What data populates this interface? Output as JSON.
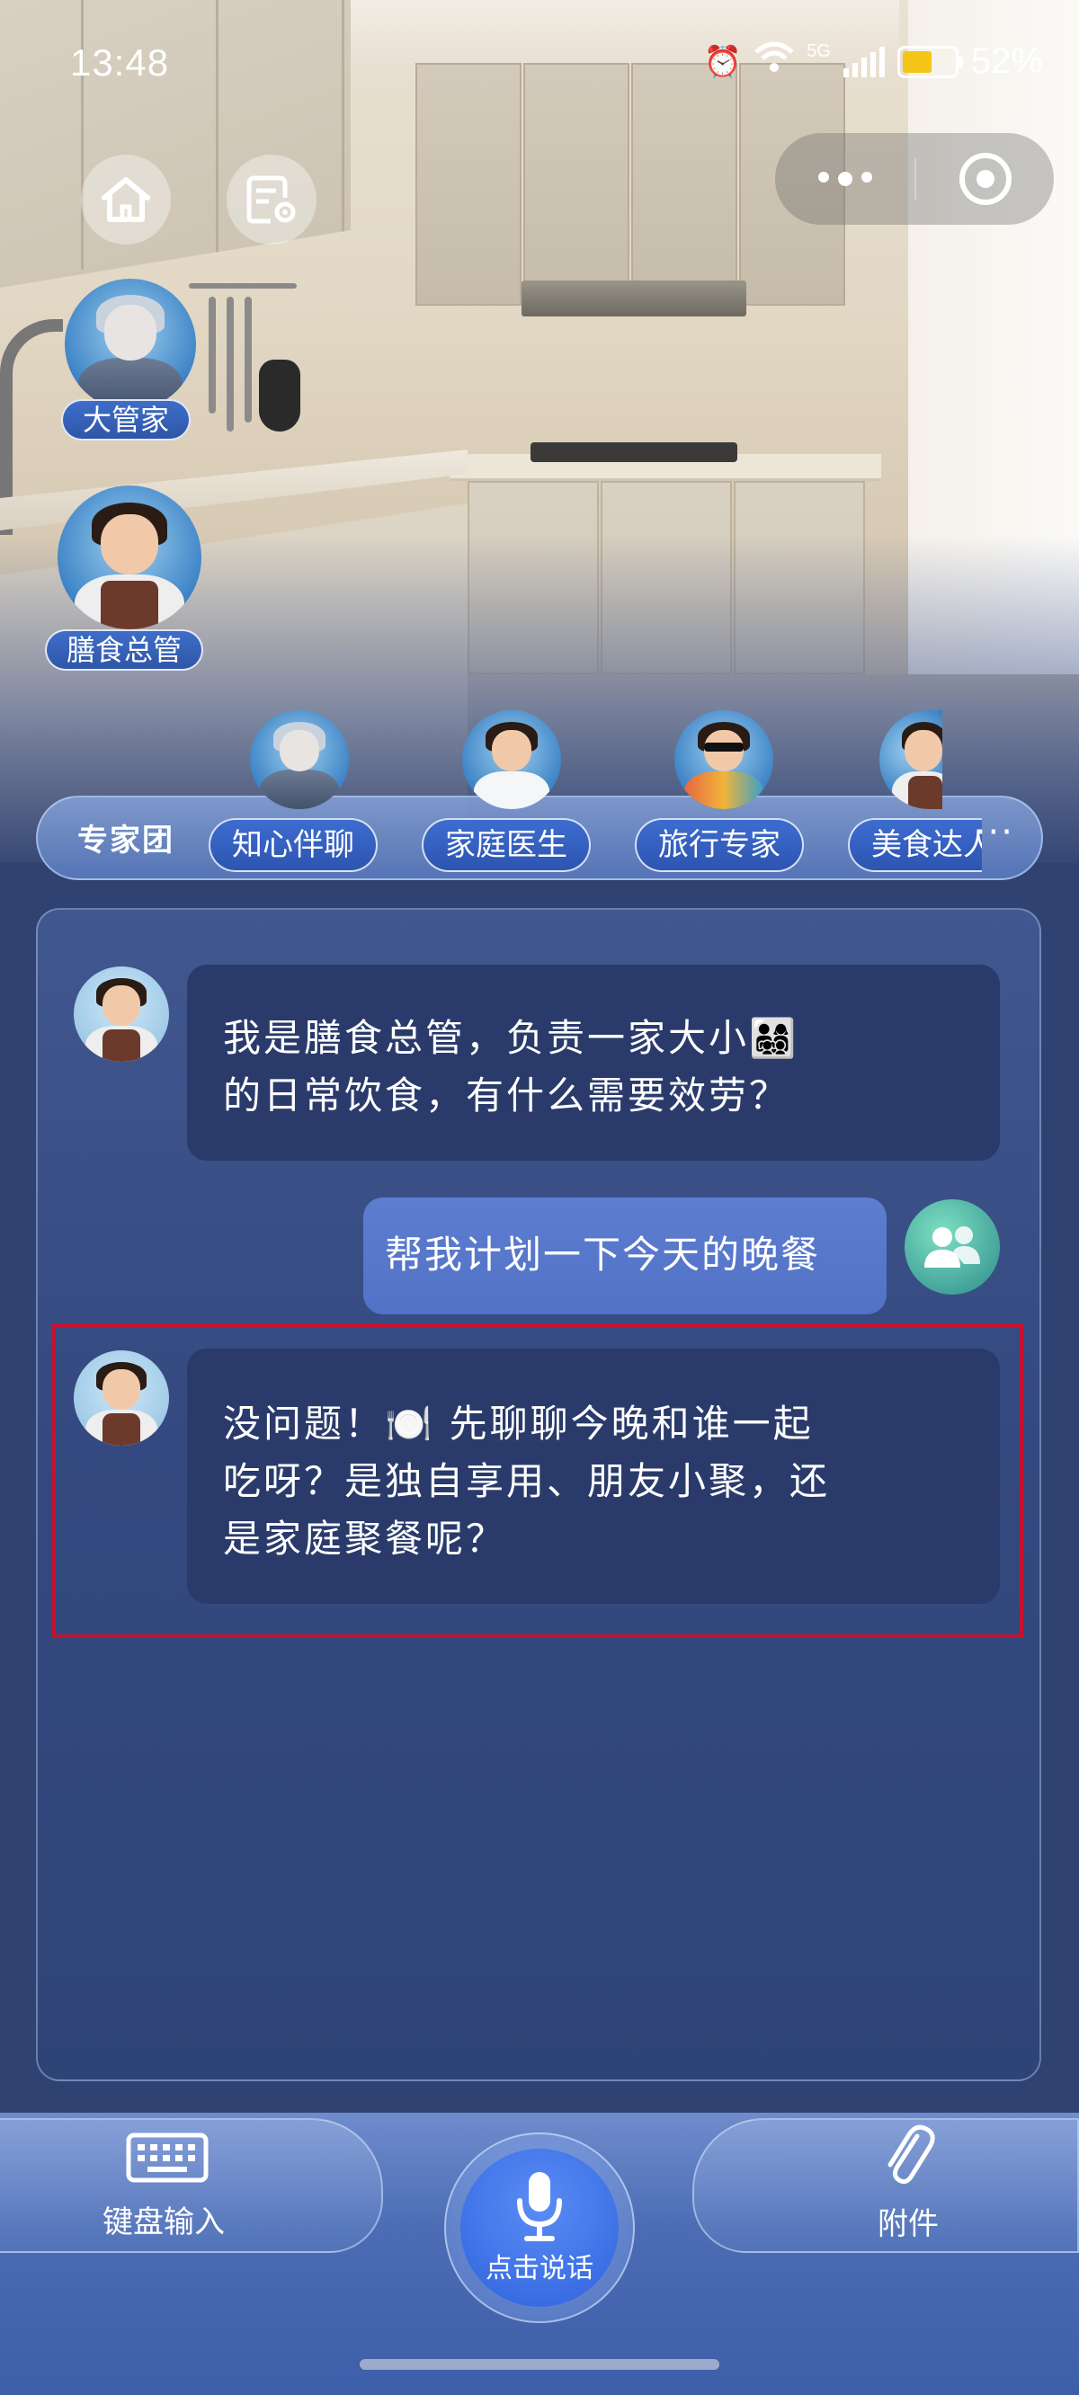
{
  "status_bar": {
    "time": "13:48",
    "network": "5G",
    "battery": "52%"
  },
  "characters": {
    "butler": "大管家",
    "chef": "膳食总管"
  },
  "expert_group": {
    "title": "专家团",
    "experts": [
      "知心伴聊",
      "家庭医生",
      "旅行专家",
      "美食达人"
    ],
    "more": "···"
  },
  "chat": {
    "messages": [
      {
        "role": "bot",
        "text": "我是膳食总管，负责一家大小👨‍👩‍👧‍👦\n的日常饮食，有什么需要效劳？"
      },
      {
        "role": "user",
        "text": "帮我计划一下今天的晚餐"
      },
      {
        "role": "bot",
        "text": "没问题！🍽️ 先聊聊今晚和谁一起\n吃呀？是独自享用、朋友小聚，还\n是家庭聚餐呢？"
      }
    ]
  },
  "bottom_bar": {
    "keyboard_label": "键盘输入",
    "mic_label": "点击说话",
    "attach_label": "附件"
  },
  "colors": {
    "highlight": "#c8102e",
    "accent": "#2f62dd"
  }
}
